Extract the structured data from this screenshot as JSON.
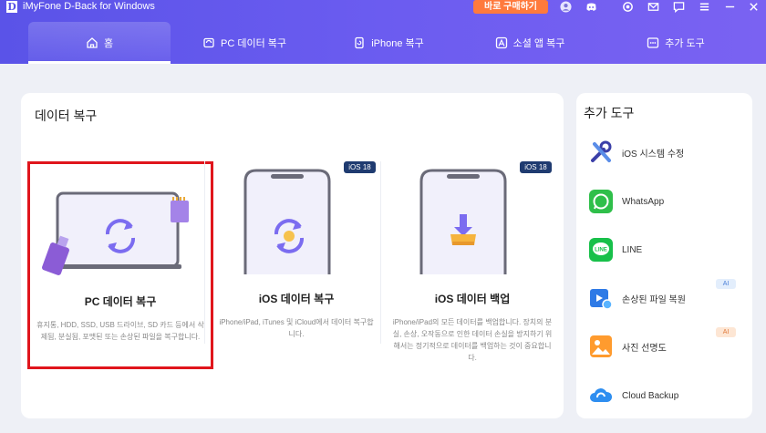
{
  "app": {
    "logo_letter": "D",
    "title": "iMyFone D-Back for Windows",
    "buy_label": "바로 구매하기"
  },
  "titlebar_icons": [
    "avatar-icon",
    "discord-icon",
    "settings-icon",
    "mail-icon",
    "chat-icon",
    "menu-icon",
    "minimize-icon",
    "close-icon"
  ],
  "tabs": [
    {
      "label": "홈",
      "icon": "home-icon",
      "active": true
    },
    {
      "label": "PC 데이터 복구",
      "icon": "pc-icon",
      "active": false
    },
    {
      "label": "iPhone 복구",
      "icon": "iphone-icon",
      "active": false
    },
    {
      "label": "소셜 앱 복구",
      "icon": "social-app-icon",
      "active": false
    },
    {
      "label": "추가 도구",
      "icon": "toolbox-icon",
      "active": false
    }
  ],
  "main": {
    "title": "데이터 복구",
    "options": [
      {
        "name": "PC 데이터 복구",
        "desc": "휴지통, HDD, SSD, USB 드라이브, SD 카드 등에서 삭제됨, 분실됨, 포맷된 또는 손상된 파일을 복구합니다.",
        "selected": true
      },
      {
        "name": "iOS 데이터 복구",
        "desc": "iPhone/iPad, iTunes 및 iCloud에서 데이터 복구합니다.",
        "badge": "iOS 18"
      },
      {
        "name": "iOS 데이터 백업",
        "desc": "iPhone/iPad의 모든 데이터를 백업합니다. 장치의 분실, 손상, 오작동으로 인한 데이터 손실을 방지하기 위해서는 정기적으로 데이터를 백업하는 것이 중요합니다.",
        "badge": "iOS 18"
      }
    ]
  },
  "side": {
    "title": "추가 도구",
    "tools": [
      {
        "label": "iOS 시스템 수정",
        "icon": "repair-tools-icon"
      },
      {
        "label": "WhatsApp",
        "icon": "whatsapp-icon"
      },
      {
        "label": "LINE",
        "icon": "line-icon"
      },
      {
        "label": "손상된 파일 복원",
        "icon": "video-repair-icon",
        "badge": "AI"
      },
      {
        "label": "사진 선명도",
        "icon": "photo-enhance-icon",
        "badge": "AI"
      },
      {
        "label": "Cloud Backup",
        "icon": "cloud-icon"
      }
    ]
  },
  "colors": {
    "header_start": "#5a53e8",
    "header_end": "#7a62f2",
    "accent": "#6b5cf0",
    "buy_button": "#ff7a3d",
    "selected_border": "#e0151c"
  }
}
